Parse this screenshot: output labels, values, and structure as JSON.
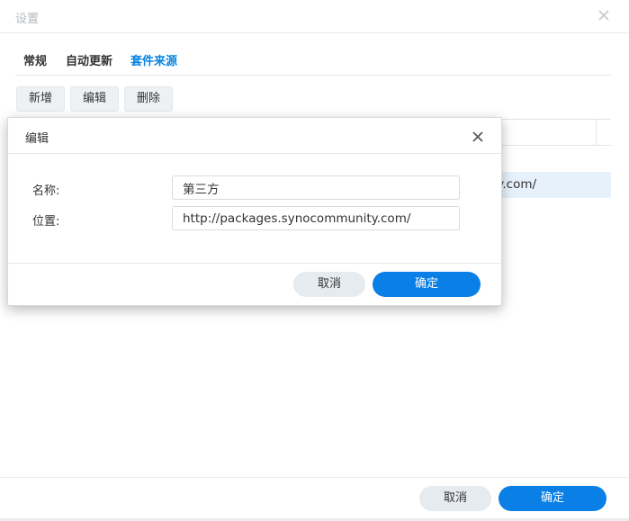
{
  "window": {
    "title": "设置"
  },
  "tabs": [
    {
      "label": "常规",
      "active": false
    },
    {
      "label": "自动更新",
      "active": false
    },
    {
      "label": "套件来源",
      "active": true
    }
  ],
  "toolbar": {
    "new_label": "新增",
    "edit_label": "编辑",
    "delete_label": "删除"
  },
  "grid": {
    "rows": [
      {
        "location_visible": "ty.com/",
        "selected": true
      }
    ]
  },
  "footer": {
    "cancel_label": "取消",
    "ok_label": "确定"
  },
  "dialog": {
    "title": "编辑",
    "name_label": "名称:",
    "name_value": "第三方",
    "location_label": "位置:",
    "location_value": "http://packages.synocommunity.com/",
    "cancel_label": "取消",
    "ok_label": "确定"
  },
  "colors": {
    "accent": "#0a7fe6",
    "active_tab": "#0a84e0",
    "selected_row": "#e7f1fc",
    "secondary_button": "#e6ebf0"
  },
  "icons": {
    "window_close": "close-icon",
    "dialog_close": "close-icon"
  }
}
